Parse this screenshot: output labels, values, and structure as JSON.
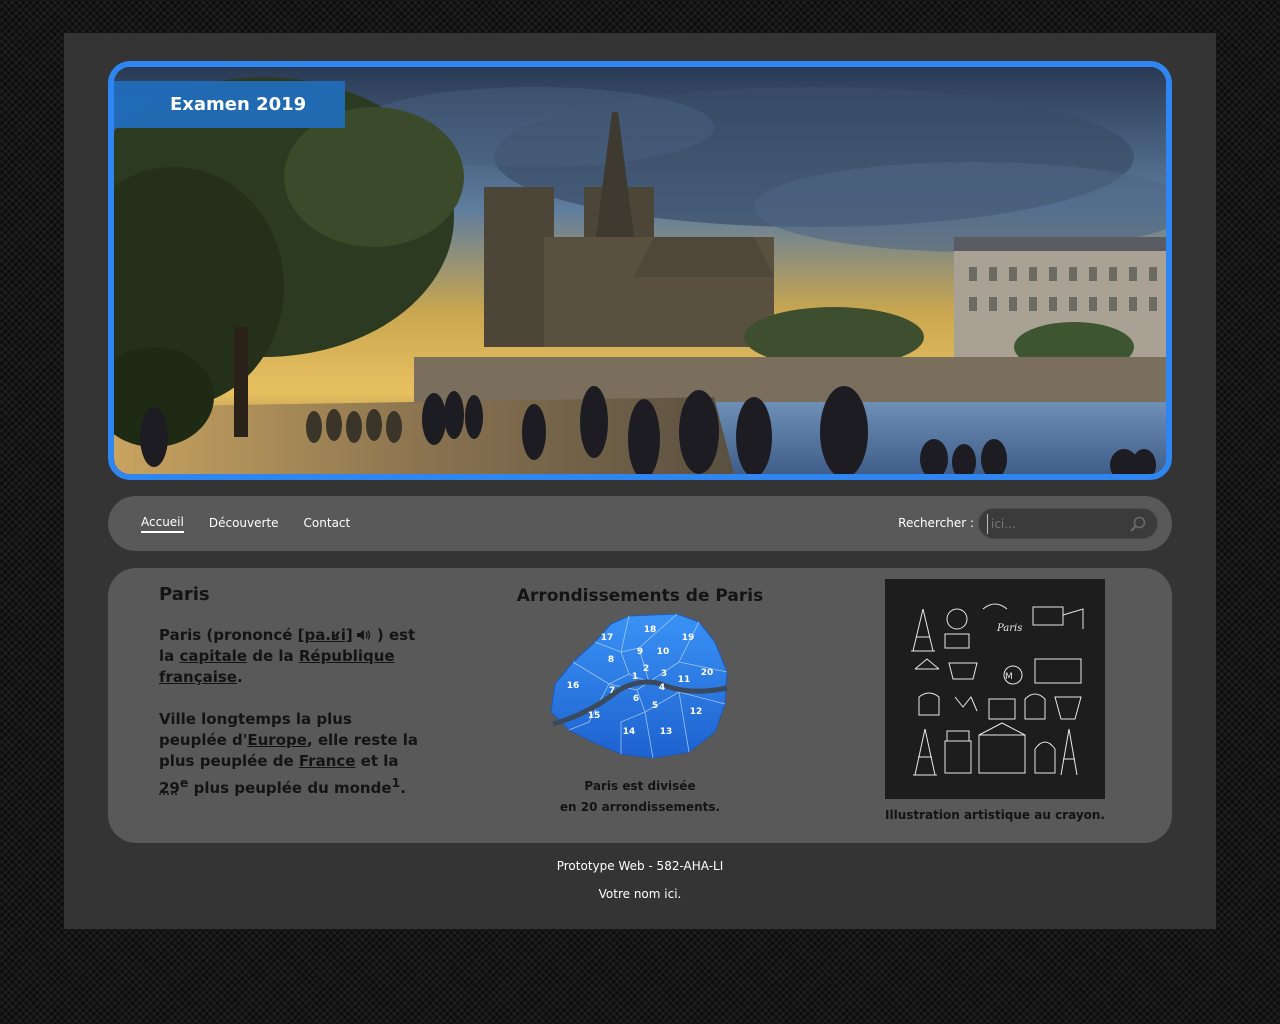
{
  "banner": {
    "title": "Examen 2019"
  },
  "nav": {
    "items": [
      {
        "label": "Accueil",
        "active": true
      },
      {
        "label": "Découverte",
        "active": false
      },
      {
        "label": "Contact",
        "active": false
      }
    ],
    "search_label": "Rechercher :",
    "search_placeholder": "ici...",
    "search_icon": "search-icon"
  },
  "content": {
    "paris": {
      "title": "Paris",
      "p1_a": "Paris (prononcé ",
      "p1_ipa": "[pa.ʁi]",
      "p1_b": " ) est la ",
      "p1_link1": "capitale",
      "p1_c": " de la ",
      "p1_link2": "République française",
      "p1_d": ".",
      "p2_a": "Ville longtemps la plus peuplée d'",
      "p2_link1": "Europe",
      "p2_b": ", elle reste la plus peuplée de ",
      "p2_link2": "France",
      "p2_c": " et la ",
      "p2_rank": "29",
      "p2_sup": "e",
      "p2_d": " plus peuplée du monde",
      "p2_ref": "1",
      "p2_e": "."
    },
    "arrondissements": {
      "title": "Arrondissements de Paris",
      "caption_line1": "Paris est divisée",
      "caption_line2": "en 20 arrondissements.",
      "labels": [
        "1",
        "2",
        "3",
        "4",
        "5",
        "6",
        "7",
        "8",
        "9",
        "10",
        "11",
        "12",
        "13",
        "14",
        "15",
        "16",
        "17",
        "18",
        "19",
        "20"
      ]
    },
    "illustration": {
      "caption": "Illustration artistique au crayon."
    }
  },
  "footer": {
    "line1": "Prototype Web - 582-AHA-LI",
    "line2": "Votre nom ici."
  },
  "colors": {
    "accent": "#2f86f0",
    "panel": "#595959",
    "page": "#343434",
    "map_blue": "#2e86f0"
  }
}
